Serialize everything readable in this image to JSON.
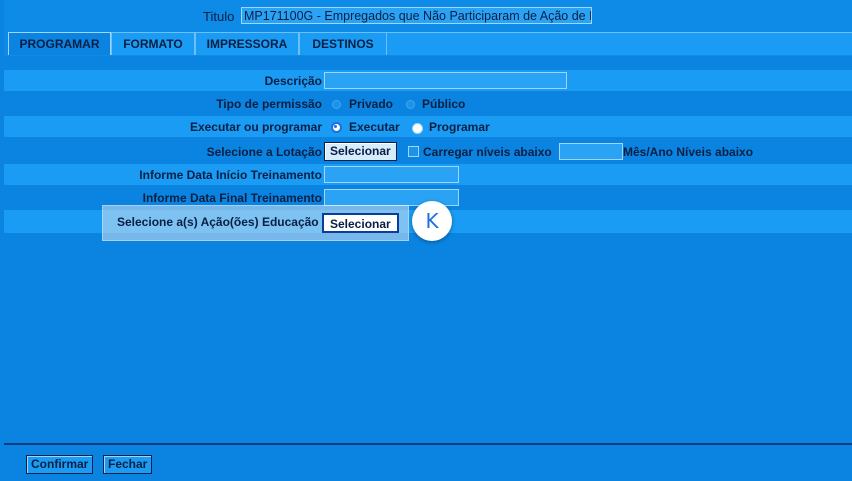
{
  "header": {
    "title_label": "Titulo",
    "title_value": "MP171100G - Empregados que Não Participaram de Ação de E"
  },
  "tabs": [
    {
      "label": "PROGRAMAR",
      "active": true
    },
    {
      "label": "FORMATO",
      "active": false
    },
    {
      "label": "IMPRESSORA",
      "active": false
    },
    {
      "label": "DESTINOS",
      "active": false
    }
  ],
  "form": {
    "descricao_label": "Descrição",
    "descricao_value": "",
    "permissao_label": "Tipo de permissão",
    "permissao_options": [
      "Privado",
      "Público"
    ],
    "permissao_selected": "",
    "executar_label": "Executar ou programar",
    "executar_options": [
      "Executar",
      "Programar"
    ],
    "executar_selected": "Executar",
    "lotacao_label": "Selecione a Lotação",
    "lotacao_button": "Selecionar",
    "carregar_label": "Carregar níveis abaixo",
    "niveis_value": "",
    "niveis_suffix": "Mês/Ano Níveis abaixo",
    "data_inicio_label": "Informe Data Início Treinamento",
    "data_inicio_value": "",
    "data_final_label": "Informe Data Final Treinamento",
    "data_final_value": "",
    "acoes_label": "Selecione a(s) Ação(ões) Educação",
    "acoes_button": "Selecionar"
  },
  "marker": {
    "letter": "K"
  },
  "footer": {
    "confirm_label": "Confirmar",
    "close_label": "Fechar"
  }
}
